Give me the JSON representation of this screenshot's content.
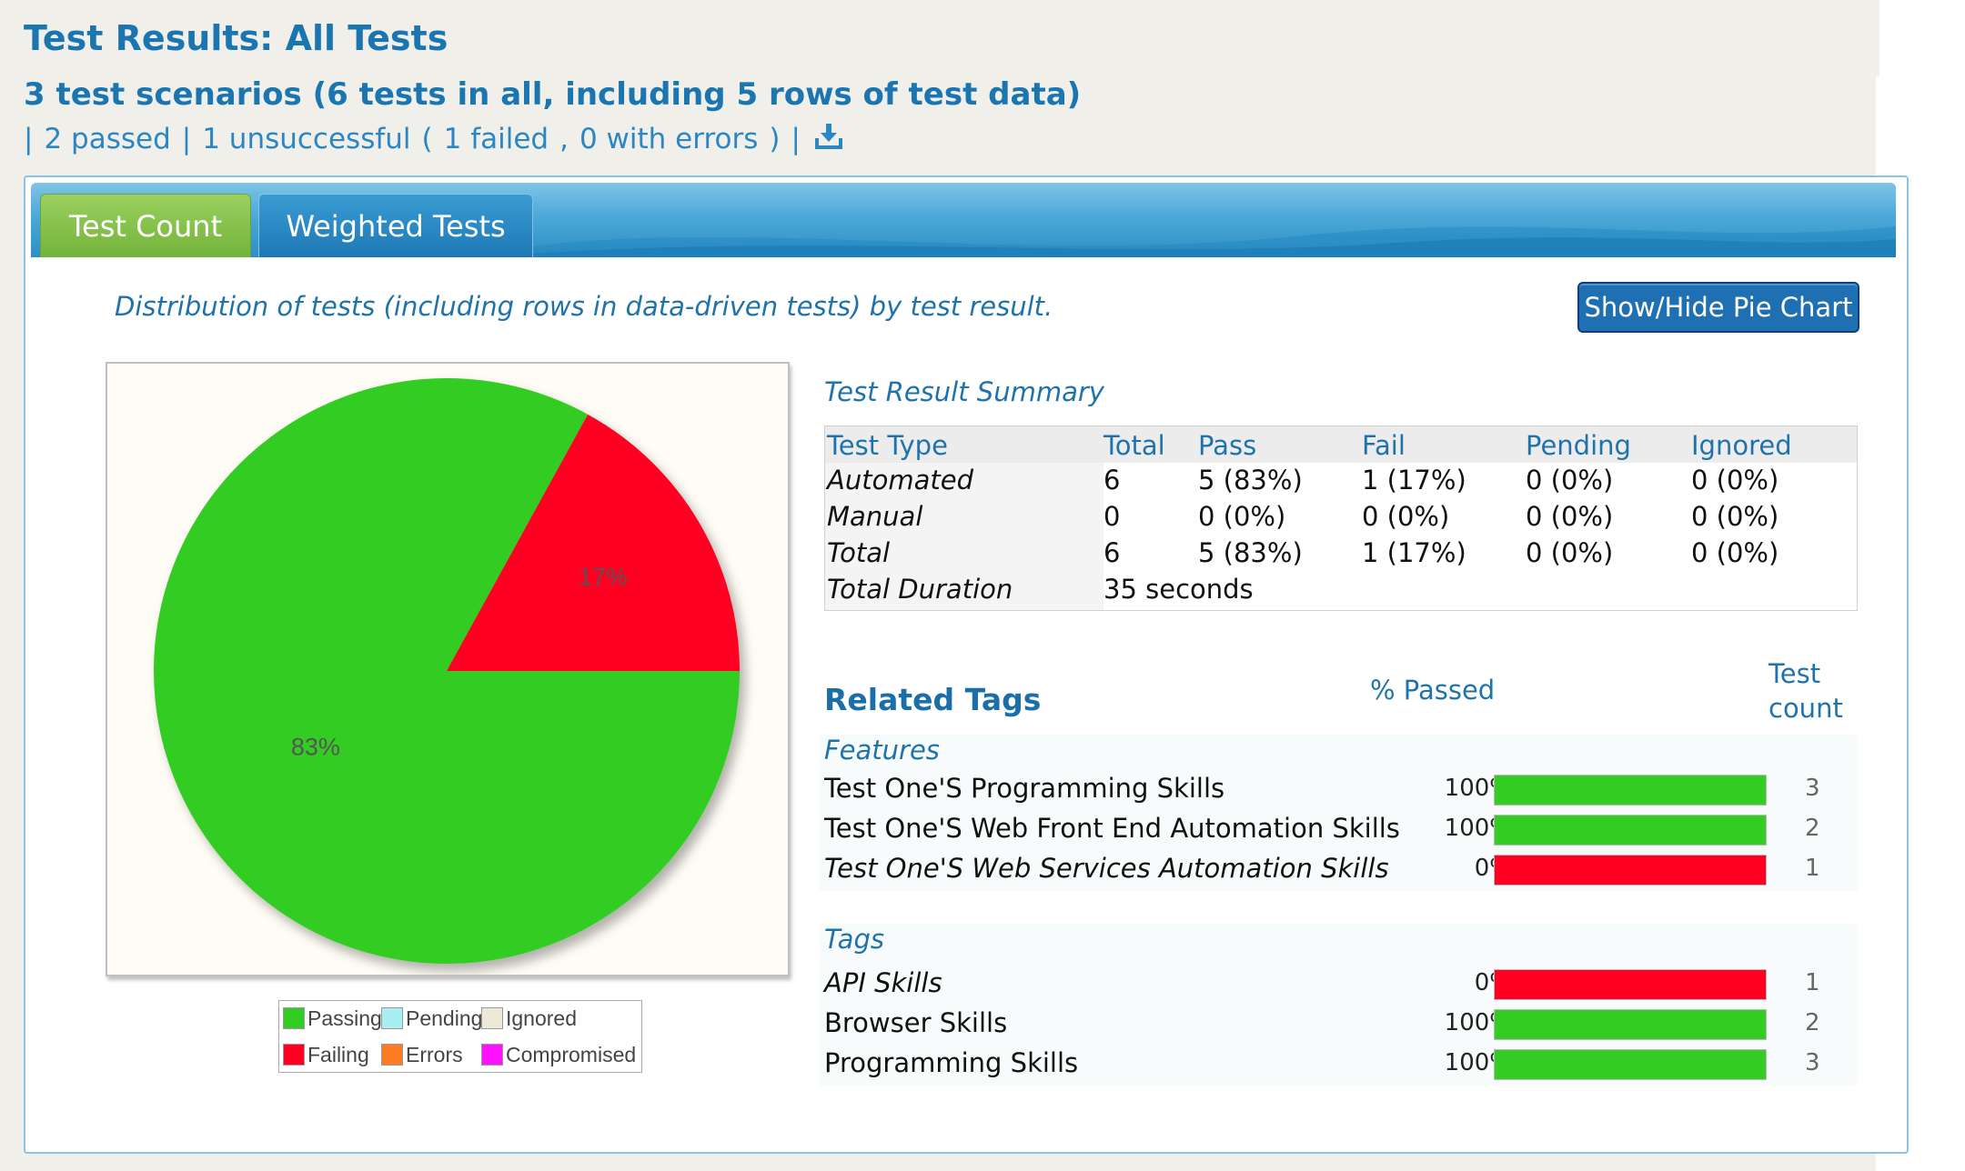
{
  "header": {
    "title": "Test Results: All Tests",
    "subtitle": "3 test scenarios (6 tests in all, including 5 rows of test data)",
    "stats": {
      "sep": "|",
      "passed": "2 passed",
      "unsuccessful": "1 unsuccessful",
      "open_paren": "(",
      "failed": "1 failed",
      "comma": ",",
      "errors": "0 with errors",
      "close_paren": ")",
      "download_icon": "download-icon"
    }
  },
  "tabs": [
    {
      "label": "Test Count",
      "active": true
    },
    {
      "label": "Weighted Tests",
      "active": false
    }
  ],
  "description": "Distribution of tests (including rows in data-driven tests) by test result.",
  "show_hide_button": "Show/Hide Pie Chart",
  "colors": {
    "passing": "#33cc22",
    "failing": "#ff0022",
    "pending": "#a8eef2",
    "ignored": "#ece9d8",
    "errors": "#ff7b22",
    "compromised": "#ff11ff"
  },
  "chart_data": {
    "type": "pie",
    "slices": [
      {
        "name": "Passing",
        "value": 83,
        "label": "83%",
        "color": "#33cc22"
      },
      {
        "name": "Failing",
        "value": 17,
        "label": "17%",
        "color": "#ff0022"
      }
    ],
    "legend": [
      "Passing",
      "Pending",
      "Ignored",
      "Failing",
      "Errors",
      "Compromised"
    ],
    "legend_position": "bottom"
  },
  "summary": {
    "title": "Test Result Summary",
    "headers": [
      "Test Type",
      "Total",
      "Pass",
      "Fail",
      "Pending",
      "Ignored"
    ],
    "rows": [
      [
        "Automated",
        "6",
        "5 (83%)",
        "1 (17%)",
        "0 (0%)",
        "0 (0%)"
      ],
      [
        "Manual",
        "0",
        "0 (0%)",
        "0 (0%)",
        "0 (0%)",
        "0 (0%)"
      ],
      [
        "Total",
        "6",
        "5 (83%)",
        "1 (17%)",
        "0 (0%)",
        "0 (0%)"
      ]
    ],
    "duration_label": "Total Duration",
    "duration_value": "35 seconds"
  },
  "related_tags": {
    "title": "Related Tags",
    "pct_header": "% Passed",
    "count_header_line1": "Test",
    "count_header_line2": "count",
    "groups": [
      {
        "name": "Features",
        "items": [
          {
            "name": "Test One'S Programming Skills",
            "pct": "100%",
            "passed_fraction": 1.0,
            "count": "3",
            "italic": false
          },
          {
            "name": "Test One'S Web Front End Automation Skills",
            "pct": "100%",
            "passed_fraction": 1.0,
            "count": "2",
            "italic": false
          },
          {
            "name": "Test One'S Web Services Automation Skills",
            "pct": "0%",
            "passed_fraction": 0.0,
            "count": "1",
            "italic": true
          }
        ]
      },
      {
        "name": "Tags",
        "items": [
          {
            "name": "API Skills",
            "pct": "0%",
            "passed_fraction": 0.0,
            "count": "1",
            "italic": true
          },
          {
            "name": "Browser Skills",
            "pct": "100%",
            "passed_fraction": 1.0,
            "count": "2",
            "italic": false
          },
          {
            "name": "Programming Skills",
            "pct": "100%",
            "passed_fraction": 1.0,
            "count": "3",
            "italic": false
          }
        ]
      }
    ]
  }
}
